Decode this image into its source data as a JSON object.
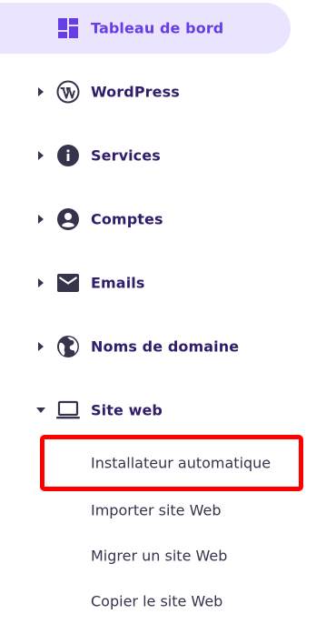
{
  "sidebar": {
    "items": [
      {
        "label": "Tableau de bord",
        "icon": "dashboard-icon",
        "active": true
      },
      {
        "label": "WordPress",
        "icon": "wordpress-icon"
      },
      {
        "label": "Services",
        "icon": "info-icon"
      },
      {
        "label": "Comptes",
        "icon": "account-icon"
      },
      {
        "label": "Emails",
        "icon": "mail-icon"
      },
      {
        "label": "Noms de domaine",
        "icon": "globe-icon"
      },
      {
        "label": "Site web",
        "icon": "laptop-icon",
        "expanded": true
      }
    ],
    "subitems": [
      {
        "label": "Installateur automatique",
        "highlighted": true
      },
      {
        "label": "Importer site Web"
      },
      {
        "label": "Migrer un site Web"
      },
      {
        "label": "Copier le site Web"
      }
    ]
  },
  "colors": {
    "accent": "#673de6",
    "active_bg": "#ebe4ff",
    "text_dark": "#2f1c6a",
    "icon_dark": "#36344d",
    "highlight_border": "#ff0000"
  }
}
